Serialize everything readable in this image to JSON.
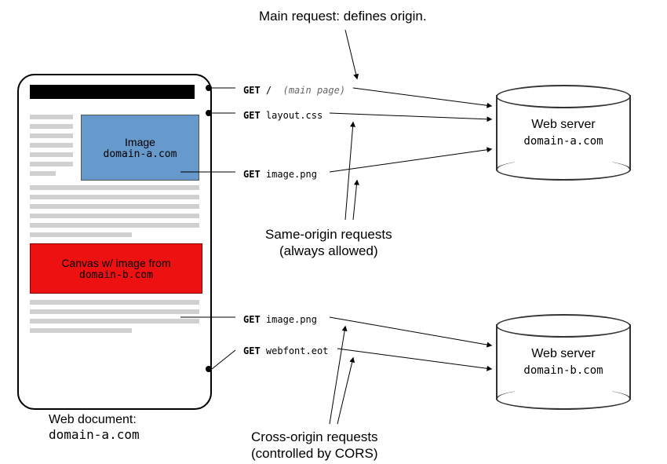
{
  "document": {
    "caption_text": "Web document:",
    "caption_domain": "domain-a.com",
    "image_label": "Image",
    "image_domain": "domain-a.com",
    "canvas_label": "Canvas w/ image from",
    "canvas_domain": "domain-b.com"
  },
  "servers": {
    "a": {
      "label": "Web server",
      "domain": "domain-a.com"
    },
    "b": {
      "label": "Web server",
      "domain": "domain-b.com"
    }
  },
  "requests": [
    {
      "verb": "GET",
      "path": "/",
      "comment": "(main page)"
    },
    {
      "verb": "GET",
      "path": "layout.css",
      "comment": ""
    },
    {
      "verb": "GET",
      "path": "image.png",
      "comment": ""
    },
    {
      "verb": "GET",
      "path": "image.png",
      "comment": ""
    },
    {
      "verb": "GET",
      "path": "webfont.eot",
      "comment": ""
    }
  ],
  "notes": {
    "top": "Main request: defines origin.",
    "mid_l1": "Same-origin requests",
    "mid_l2": "(always allowed)",
    "bot_l1": "Cross-origin requests",
    "bot_l2": "(controlled by CORS)"
  }
}
